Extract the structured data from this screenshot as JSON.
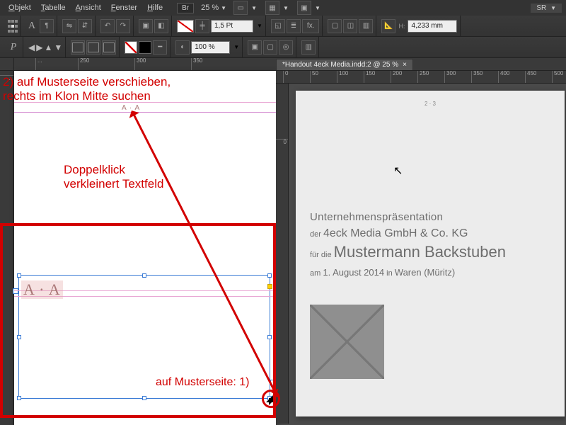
{
  "menu": {
    "items": [
      "Objekt",
      "Tabelle",
      "Ansicht",
      "Fenster",
      "Hilfe"
    ],
    "br": "Br",
    "zoom": "25 %",
    "sr": "SR"
  },
  "toolbar": {
    "stroke_weight": "1,5 Pt",
    "opacity": "100 %",
    "dim_h": "4,233 mm",
    "fx": "fx."
  },
  "tab": {
    "title": "*Handout 4eck Media.indd:2 @ 25 %",
    "close": "×"
  },
  "ruler_top_left": [
    "...",
    "250",
    "300",
    "350"
  ],
  "ruler_top_right": [
    "0",
    "50",
    "100",
    "150",
    "200",
    "250",
    "300",
    "350",
    "400",
    "450",
    "500"
  ],
  "ruler_v_right": [
    "0"
  ],
  "spread": {
    "pagenum": "2 · 3"
  },
  "doc": {
    "line1": "Unternehmenspräsentation",
    "line2a": "der ",
    "line2b": "4eck Media GmbH & Co. KG",
    "line3a": "für die ",
    "line3b": "Mustermann Backstuben",
    "line4a": "am ",
    "line4b": "1. August 2014",
    "line4c": " in ",
    "line4d": "Waren (Müritz)"
  },
  "master_marker_small": "A · A",
  "master_marker_big": "A · A",
  "annotations": {
    "top1": "2) auf Musterseite verschieben,",
    "top2": "rechts im Klon Mitte suchen",
    "mid1": "Doppelklick",
    "mid2": "verkleinert Textfeld",
    "bottom": "auf Musterseite: 1)"
  }
}
